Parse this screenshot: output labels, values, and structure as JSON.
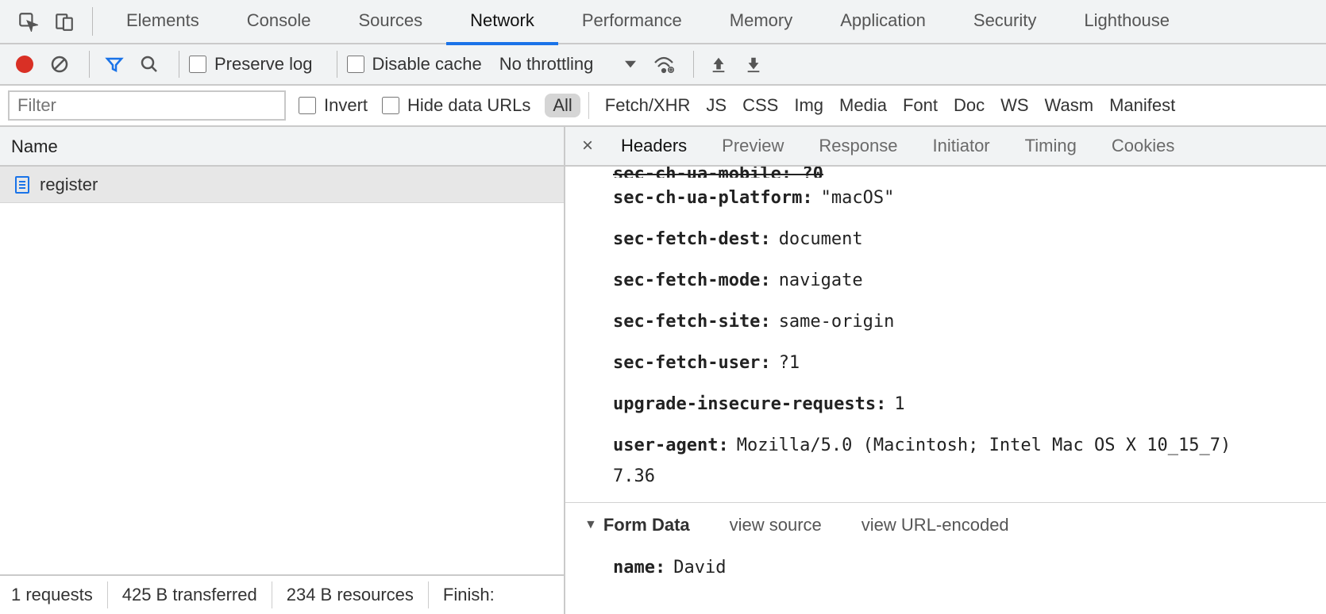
{
  "tabs": {
    "items": [
      "Elements",
      "Console",
      "Sources",
      "Network",
      "Performance",
      "Memory",
      "Application",
      "Security",
      "Lighthouse"
    ],
    "active": "Network"
  },
  "toolbar": {
    "preserve_log": "Preserve log",
    "disable_cache": "Disable cache",
    "no_throttling": "No throttling"
  },
  "filterbar": {
    "filter_placeholder": "Filter",
    "invert": "Invert",
    "hide_data_urls": "Hide data URLs",
    "chips": [
      "All",
      "Fetch/XHR",
      "JS",
      "CSS",
      "Img",
      "Media",
      "Font",
      "Doc",
      "WS",
      "Wasm",
      "Manifest"
    ],
    "active_chip": "All"
  },
  "left": {
    "header": "Name",
    "request": "register",
    "status": {
      "requests": "1 requests",
      "transferred": "425 B transferred",
      "resources": "234 B resources",
      "finish": "Finish:"
    }
  },
  "detail": {
    "tabs": [
      "Headers",
      "Preview",
      "Response",
      "Initiator",
      "Timing",
      "Cookies"
    ],
    "active": "Headers",
    "cut_header": "sec-ch-ua-mobile: ?0",
    "headers": [
      {
        "k": "sec-ch-ua-platform",
        "v": "\"macOS\""
      },
      {
        "k": "sec-fetch-dest",
        "v": "document"
      },
      {
        "k": "sec-fetch-mode",
        "v": "navigate"
      },
      {
        "k": "sec-fetch-site",
        "v": "same-origin"
      },
      {
        "k": "sec-fetch-user",
        "v": "?1"
      },
      {
        "k": "upgrade-insecure-requests",
        "v": "1"
      },
      {
        "k": "user-agent",
        "v": "Mozilla/5.0 (Macintosh; Intel Mac OS X 10_15_7)"
      }
    ],
    "trailing": "7.36",
    "form_section": {
      "title": "Form Data",
      "view_source": "view source",
      "view_url_encoded": "view URL-encoded",
      "entry_key": "name",
      "entry_value": "David"
    }
  }
}
